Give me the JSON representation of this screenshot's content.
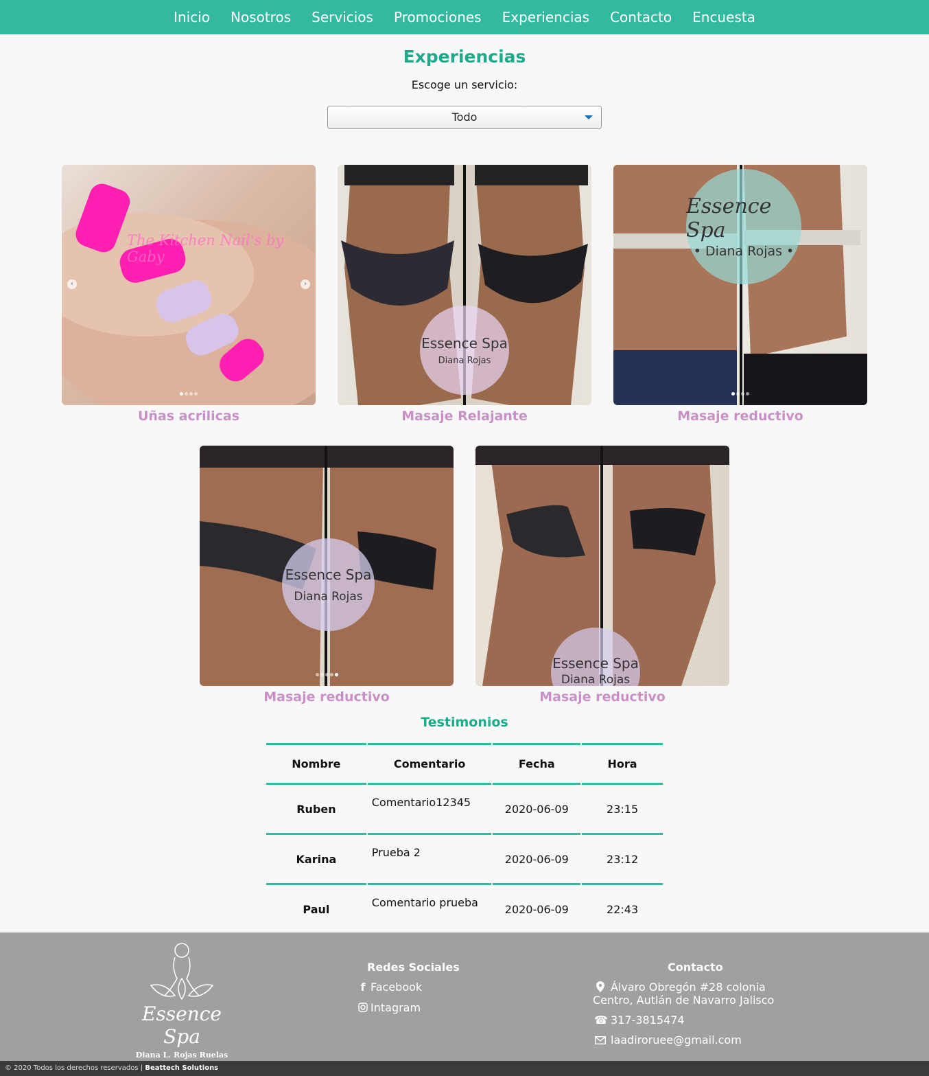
{
  "nav": {
    "items": [
      "Inicio",
      "Nosotros",
      "Servicios",
      "Promociones",
      "Experiencias",
      "Contacto",
      "Encuesta"
    ]
  },
  "page": {
    "title": "Experiencias",
    "select_label": "Escoge un servicio:",
    "select_value": "Todo"
  },
  "gallery": [
    {
      "caption": "Uñas acrilicas",
      "watermark": "The Kitchen Nail's by Gaby"
    },
    {
      "caption": "Masaje Relajante",
      "watermark_line1": "Essence Spa",
      "watermark_line2": "Diana Rojas"
    },
    {
      "caption": "Masaje reductivo",
      "watermark_line1": "Essence Spa",
      "watermark_line2": "• Diana Rojas •"
    },
    {
      "caption": "Masaje reductivo",
      "watermark_line1": "Essence Spa",
      "watermark_line2": "Diana Rojas"
    },
    {
      "caption": "Masaje reductivo",
      "watermark_line1": "Essence Spa",
      "watermark_line2": "Diana Rojas"
    }
  ],
  "testimonios": {
    "title": "Testimonios",
    "headers": [
      "Nombre",
      "Comentario",
      "Fecha",
      "Hora"
    ],
    "rows": [
      {
        "nombre": "Ruben",
        "comentario": "Comentario12345",
        "fecha": "2020-06-09",
        "hora": "23:15"
      },
      {
        "nombre": "Karina",
        "comentario": "Prueba 2",
        "fecha": "2020-06-09",
        "hora": "23:12"
      },
      {
        "nombre": "Paul",
        "comentario": "Comentario prueba",
        "fecha": "2020-06-09",
        "hora": "22:43"
      }
    ]
  },
  "footer": {
    "logo_name": "Essence Spa",
    "logo_sub": "Diana L. Rojas Ruelas",
    "social_title": "Redes Sociales",
    "facebook": "Facebook",
    "instagram": "Intagram",
    "contact_title": "Contacto",
    "address_line1": "Álvaro Obregón #28 colonia",
    "address_line2": "Centro, Autlán de Navarro Jalisco",
    "phone": "317-3815474",
    "email": "laadiroruee@gmail.com",
    "copyright": "© 2020 Todos los derechos reservados |",
    "company": "Beattech Solutions"
  },
  "colors": {
    "accent": "#33b9a0",
    "title": "#1faa8c",
    "caption": "#c98fc7",
    "footer": "#a0a0a0"
  }
}
